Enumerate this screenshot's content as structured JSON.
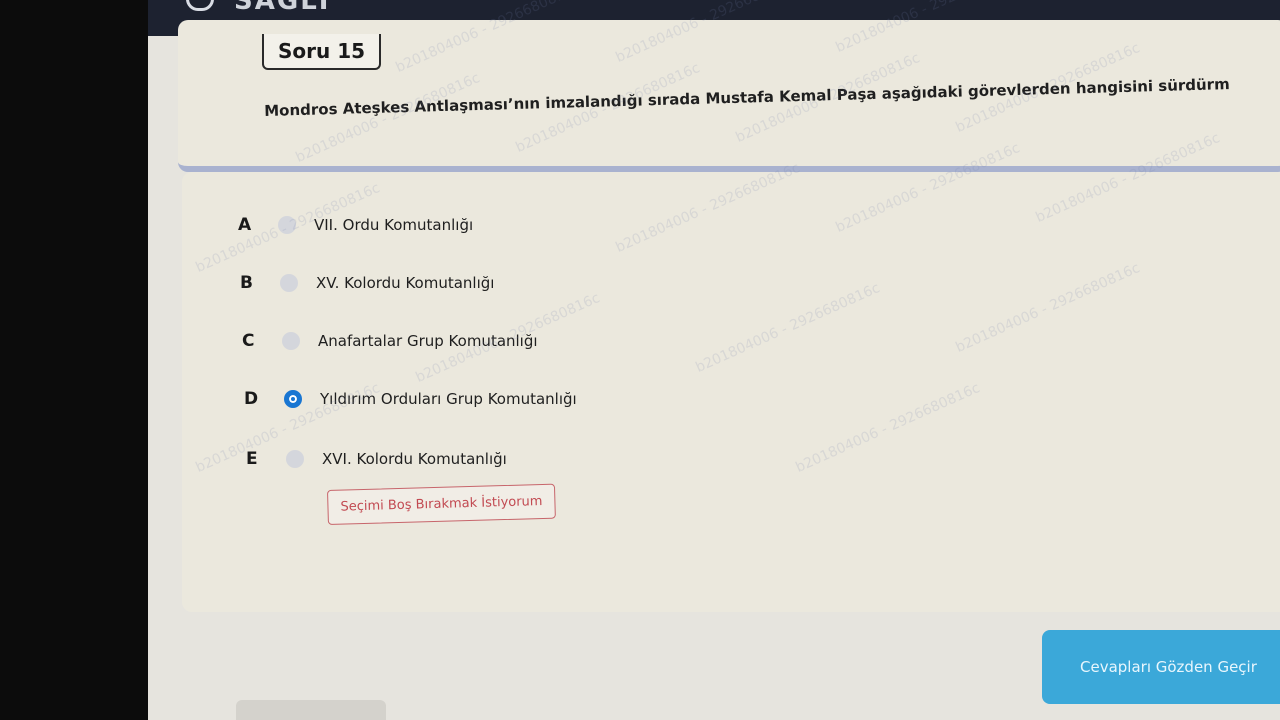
{
  "app": {
    "brand_text": "SAGLI"
  },
  "question": {
    "tab_label": "Soru 15",
    "text": "Mondros Ateşkes Antlaşması’nın imzalandığı sırada Mustafa Kemal Paşa aşağıdaki görevlerden hangisini sürdürm"
  },
  "options": [
    {
      "letter": "A",
      "label": "VII. Ordu Komutanlığı",
      "selected": false
    },
    {
      "letter": "B",
      "label": "XV. Kolordu Komutanlığı",
      "selected": false
    },
    {
      "letter": "C",
      "label": "Anafartalar Grup Komutanlığı",
      "selected": false
    },
    {
      "letter": "D",
      "label": "Yıldırım Orduları Grup Komutanlığı",
      "selected": true
    },
    {
      "letter": "E",
      "label": "XVI. Kolordu Komutanlığı",
      "selected": false
    }
  ],
  "skip_button_label": "Seçimi Boş Bırakmak İstiyorum",
  "review_button_label": "Cevapları Gözden Geçir",
  "watermark_text": "b201804006 - 2926680816c",
  "colors": {
    "accent": "#1976d2",
    "review_button": "#3ba8d9",
    "skip_border": "#c7656b",
    "card_bg": "#ebe8dd"
  }
}
